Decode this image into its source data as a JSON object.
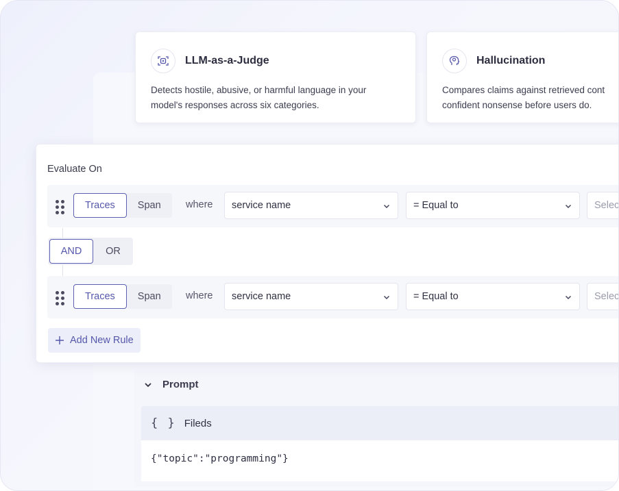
{
  "cards": [
    {
      "title": "LLM-as-a-Judge",
      "icon": "judge-scan-icon",
      "description_line1": "Detects hostile, abusive, or harmful language in your",
      "description_line2": "model's responses across six categories."
    },
    {
      "title": "Hallucination",
      "icon": "head-brain-icon",
      "description_line1": "Compares claims against retrieved cont",
      "description_line2": "confident nonsense before users do."
    }
  ],
  "evaluate": {
    "title": "Evaluate On",
    "rules": [
      {
        "scope_active": "Traces",
        "scope_other": "Span",
        "where": "where",
        "field": "service name",
        "operator": "= Equal to",
        "value_placeholder": "Selec"
      },
      {
        "scope_active": "Traces",
        "scope_other": "Span",
        "where": "where",
        "field": "service name",
        "operator": "= Equal to",
        "value_placeholder": "Selec"
      }
    ],
    "logic": {
      "and": "AND",
      "or": "OR"
    },
    "add_rule": "Add New Rule"
  },
  "prompt": {
    "label": "Prompt",
    "fields_label": "Fileds",
    "code": "{\"topic\":\"programming\"}"
  },
  "colors": {
    "accent": "#5557ab",
    "panel_bg": "#f6f7fb"
  }
}
